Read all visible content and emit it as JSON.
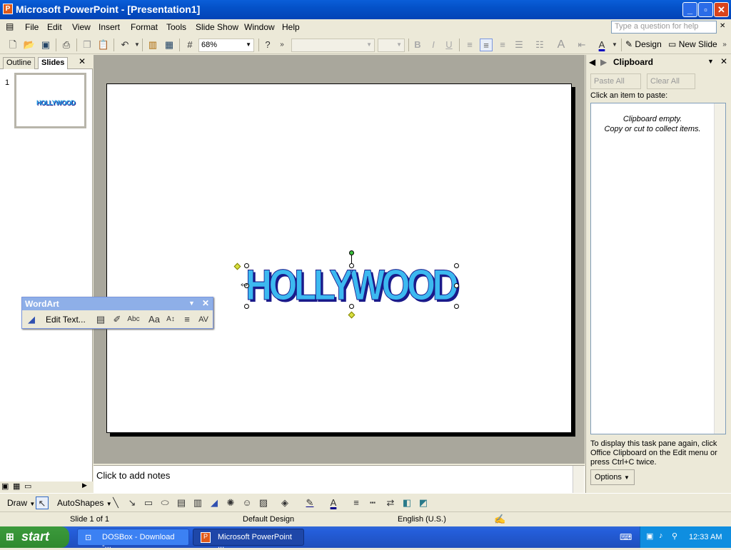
{
  "window": {
    "title": "Microsoft PowerPoint - [Presentation1]"
  },
  "menu": [
    "File",
    "Edit",
    "View",
    "Insert",
    "Format",
    "Tools",
    "Slide Show",
    "Window",
    "Help"
  ],
  "help_placeholder": "Type a question for help",
  "toolbar": {
    "zoom": "68%",
    "design_label": "Design",
    "new_slide_label": "New Slide"
  },
  "left_pane": {
    "tab_outline": "Outline",
    "tab_slides": "Slides",
    "slide_number": "1",
    "thumb_text": "HOLLYWOOD"
  },
  "slide": {
    "wordart_text": "HOLLYWOOD"
  },
  "notes": {
    "placeholder": "Click to add notes"
  },
  "task_pane": {
    "title": "Clipboard",
    "paste_all": "Paste All",
    "clear_all": "Clear All",
    "instruction": "Click an item to paste:",
    "empty_line1": "Clipboard empty.",
    "empty_line2": "Copy or cut to collect items.",
    "footer": "To display this task pane again, click Office Clipboard on the Edit menu or press Ctrl+C twice.",
    "options": "Options"
  },
  "wordart_toolbar": {
    "title": "WordArt",
    "edit_text": "Edit Text..."
  },
  "drawbar": {
    "draw": "Draw",
    "autoshapes": "AutoShapes"
  },
  "status": {
    "slide": "Slide 1 of 1",
    "design": "Default Design",
    "language": "English (U.S.)"
  },
  "taskbar": {
    "start": "start",
    "tasks": [
      "DOSBox - Download -...",
      "Microsoft PowerPoint ..."
    ],
    "clock": "12:33 AM"
  },
  "colors": {
    "wordart_fill": "#3cb9f0",
    "wordart_shadow": "#1a1a8a",
    "titlebar": "#0a5ed8"
  }
}
